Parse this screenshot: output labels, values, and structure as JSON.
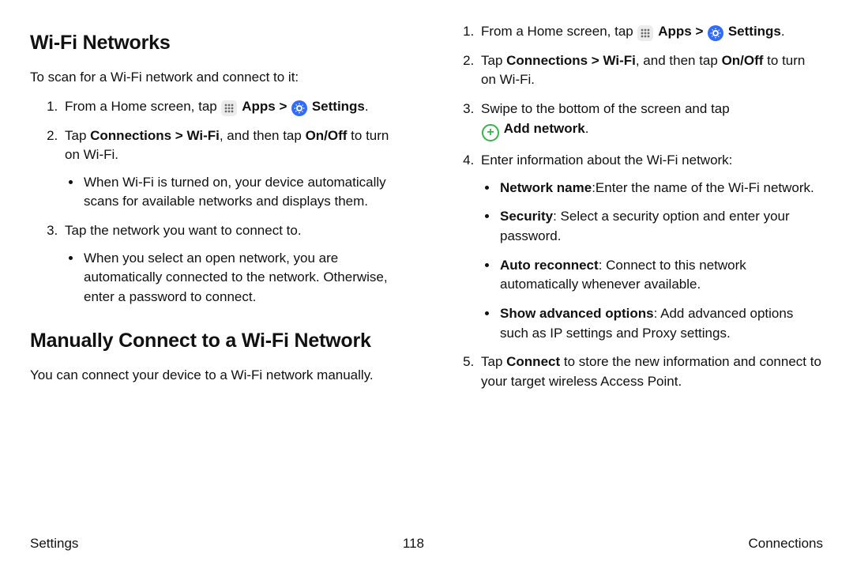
{
  "left": {
    "heading1": "Wi-Fi Networks",
    "intro": "To scan for a Wi-Fi network and connect to it:",
    "step1_a": "From a Home screen, tap ",
    "step1_apps": "Apps",
    "step1_arrow": " > ",
    "step1_settings": "Settings",
    "step1_dot": ".",
    "step2_a": "Tap ",
    "step2_b": "Connections > Wi-Fi",
    "step2_c": ", and then tap ",
    "step2_d": "On/Off",
    "step2_e": " to turn on Wi-Fi.",
    "step2_bullet": "When Wi-Fi is turned on, your device automatically scans for available networks and displays them.",
    "step3": "Tap the network you want to connect to.",
    "step3_bullet": "When you select an open network, you are automatically connected to the network. Otherwise, enter a password to connect.",
    "heading2": "Manually Connect to a Wi-Fi Network",
    "manual_intro": "You can connect your device to a Wi-Fi network manually."
  },
  "right": {
    "step1_a": "From a Home screen, tap ",
    "step1_apps": "Apps",
    "step1_arrow": " > ",
    "step1_settings": "Settings",
    "step1_dot": ".",
    "step2_a": "Tap ",
    "step2_b": "Connections > Wi-Fi",
    "step2_c": ", and then tap ",
    "step2_d": "On/Off",
    "step2_e": " to turn on Wi-Fi.",
    "step3_a": "Swipe to the bottom of the screen and tap ",
    "step3_add": "Add network",
    "step3_dot": ".",
    "step4": "Enter information about the Wi-Fi network:",
    "step4_b1_a": "Network name",
    "step4_b1_b": ":Enter the name of the Wi-Fi network.",
    "step4_b2_a": "Security",
    "step4_b2_b": ": Select a security option and enter your password.",
    "step4_b3_a": "Auto reconnect",
    "step4_b3_b": ": Connect to this network automatically whenever available.",
    "step4_b4_a": "Show advanced options",
    "step4_b4_b": ": Add advanced options such as IP settings and Proxy settings.",
    "step5_a": "Tap ",
    "step5_b": "Connect",
    "step5_c": " to store the new information and connect to your target wireless Access Point."
  },
  "footer": {
    "left": "Settings",
    "center": "118",
    "right": "Connections"
  }
}
